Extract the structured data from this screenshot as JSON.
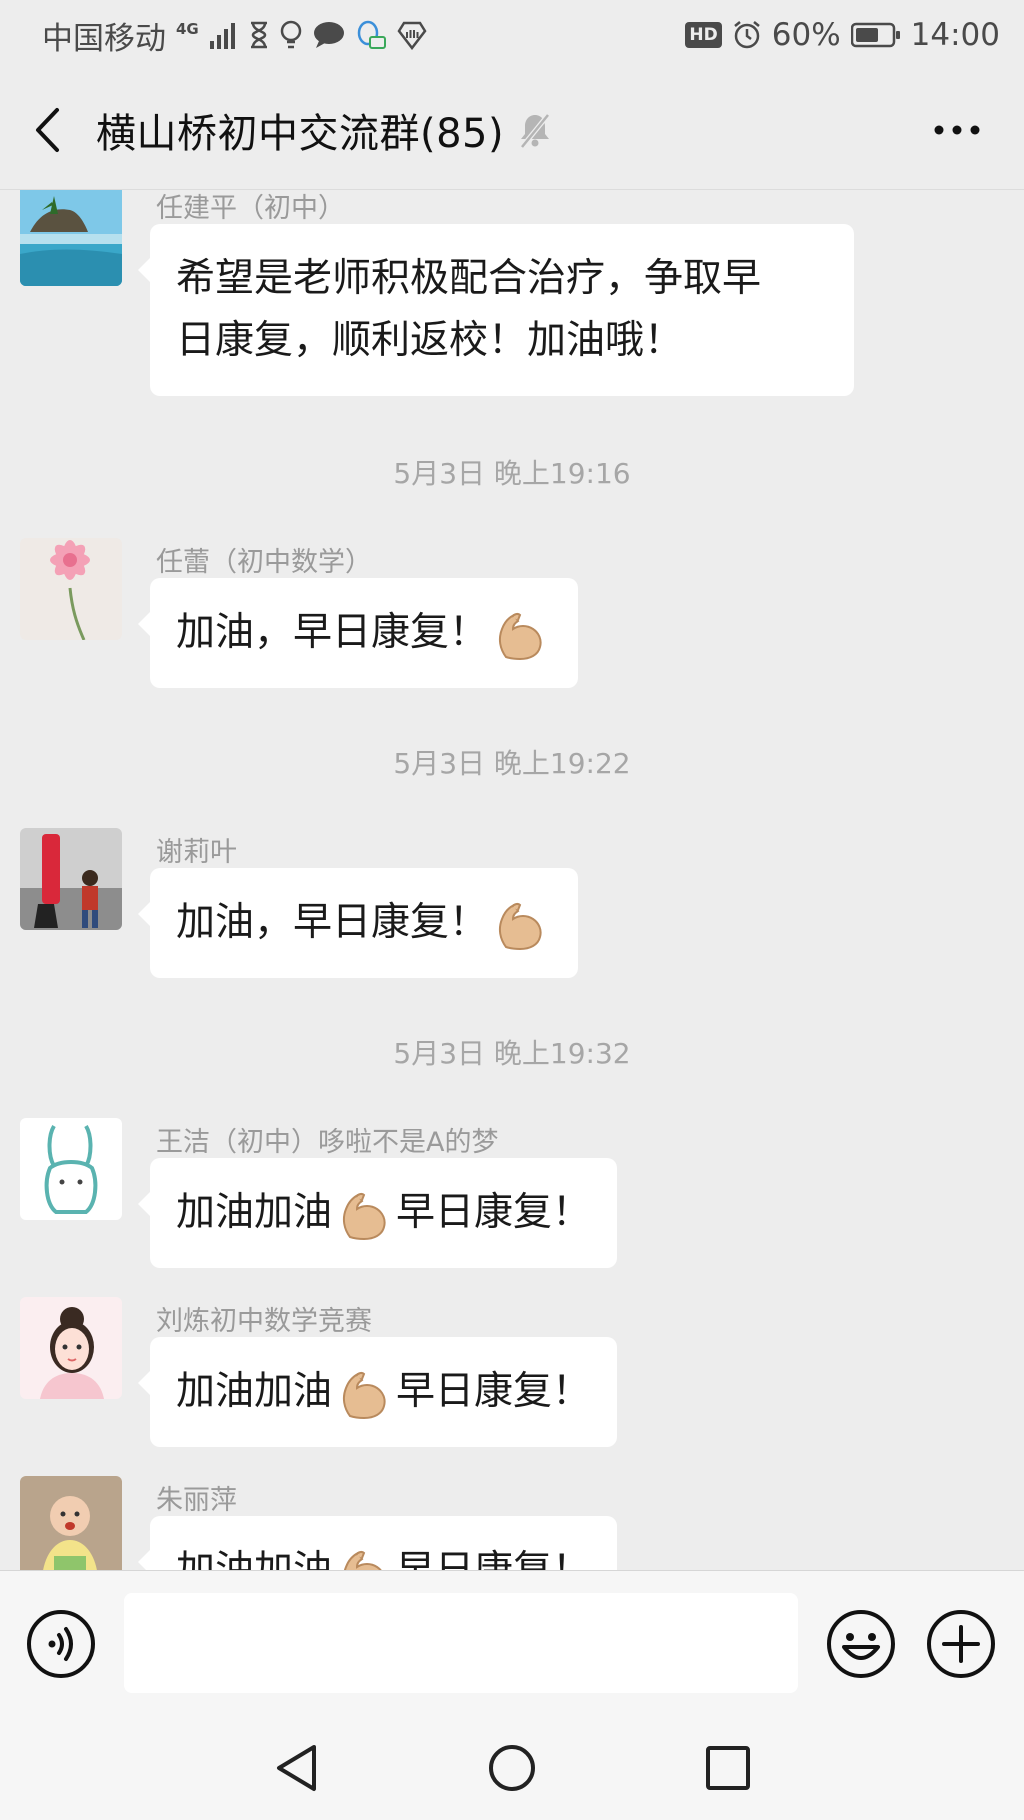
{
  "status_bar": {
    "carrier": "中国移动",
    "network": "4G",
    "hd": "HD",
    "battery": "60%",
    "time": "14:00"
  },
  "header": {
    "title": "横山桥初中交流群(85)",
    "back_icon": "chevron-left-icon",
    "mute_icon": "bell-muted-icon",
    "more_icon": "more-dots-icon"
  },
  "messages": [
    {
      "sender": "任建平（初中）",
      "parts": [
        "希望是老师积极配合治疗，争取早\n日康复，顺利返校！加油哦！"
      ]
    },
    {
      "time": "5月3日 晚上19:16",
      "sender": "任蕾（初中数学）",
      "parts": [
        "加油，早日康复！",
        ""
      ]
    },
    {
      "time": "5月3日 晚上19:22",
      "sender": "谢莉叶",
      "parts": [
        "加油，早日康复！",
        ""
      ]
    },
    {
      "time": "5月3日 晚上19:32",
      "sender": "王洁（初中）哆啦不是A的梦",
      "parts": [
        "加油加油",
        "早日康复！"
      ]
    },
    {
      "sender": "刘炼初中数学竞赛",
      "parts": [
        "加油加油",
        "早日康复！"
      ]
    },
    {
      "sender": "朱丽萍",
      "parts": [
        "加油加油",
        "早日康复！"
      ]
    }
  ],
  "emoji_name": "flexed-biceps-icon",
  "input_bar": {
    "voice_icon": "voice-icon",
    "emoji_icon": "smiley-icon",
    "plus_icon": "plus-circle-icon",
    "placeholder": ""
  },
  "nav": {
    "back_icon": "nav-back-triangle-icon",
    "home_icon": "nav-home-circle-icon",
    "recents_icon": "nav-recents-square-icon"
  },
  "colors": {
    "background": "#ededed",
    "bubble": "#ffffff",
    "muted_text": "#9a9a9a"
  }
}
